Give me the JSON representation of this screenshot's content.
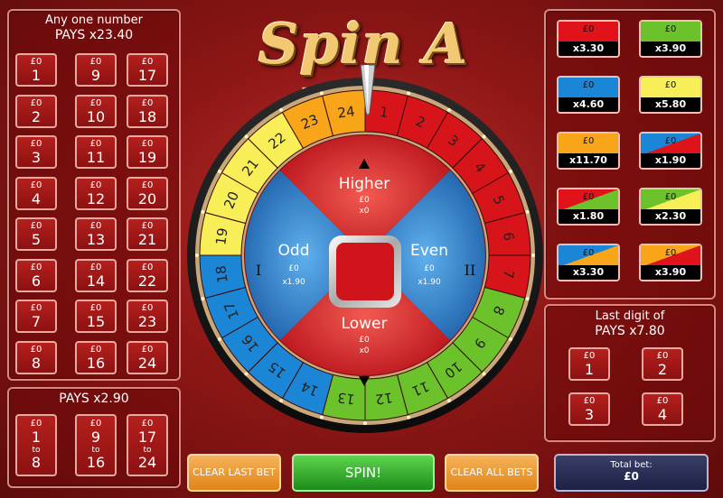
{
  "title": "Spin A Win",
  "any_number": {
    "header": "Any one number",
    "pays": "PAYS x23.40",
    "columns": [
      [
        {
          "amt": "£0",
          "num": "1"
        },
        {
          "amt": "£0",
          "num": "2"
        },
        {
          "amt": "£0",
          "num": "3"
        },
        {
          "amt": "£0",
          "num": "4"
        },
        {
          "amt": "£0",
          "num": "5"
        },
        {
          "amt": "£0",
          "num": "6"
        },
        {
          "amt": "£0",
          "num": "7"
        },
        {
          "amt": "£0",
          "num": "8"
        }
      ],
      [
        {
          "amt": "£0",
          "num": "9"
        },
        {
          "amt": "£0",
          "num": "10"
        },
        {
          "amt": "£0",
          "num": "11"
        },
        {
          "amt": "£0",
          "num": "12"
        },
        {
          "amt": "£0",
          "num": "13"
        },
        {
          "amt": "£0",
          "num": "14"
        },
        {
          "amt": "£0",
          "num": "15"
        },
        {
          "amt": "£0",
          "num": "16"
        }
      ],
      [
        {
          "amt": "£0",
          "num": "17"
        },
        {
          "amt": "£0",
          "num": "18"
        },
        {
          "amt": "£0",
          "num": "19"
        },
        {
          "amt": "£0",
          "num": "20"
        },
        {
          "amt": "£0",
          "num": "21"
        },
        {
          "amt": "£0",
          "num": "22"
        },
        {
          "amt": "£0",
          "num": "23"
        },
        {
          "amt": "£0",
          "num": "24"
        }
      ]
    ]
  },
  "range": {
    "pays": "PAYS x2.90",
    "buttons": [
      {
        "amt": "£0",
        "from": "1",
        "to_label": "to",
        "to": "8"
      },
      {
        "amt": "£0",
        "from": "9",
        "to_label": "to",
        "to": "16"
      },
      {
        "amt": "£0",
        "from": "17",
        "to_label": "to",
        "to": "24"
      }
    ]
  },
  "color_bets": [
    {
      "amt": "£0",
      "odds": "x3.30",
      "c1": "#e0121a",
      "c2": "#e0121a"
    },
    {
      "amt": "£0",
      "odds": "x3.90",
      "c1": "#6cc22a",
      "c2": "#6cc22a"
    },
    {
      "amt": "£0",
      "odds": "x4.60",
      "c1": "#1c86d6",
      "c2": "#1c86d6"
    },
    {
      "amt": "£0",
      "odds": "x5.80",
      "c1": "#f7ee58",
      "c2": "#f7ee58"
    },
    {
      "amt": "£0",
      "odds": "x11.70",
      "c1": "#f9a51a",
      "c2": "#f9a51a"
    },
    {
      "amt": "£0",
      "odds": "x1.90",
      "c1": "#1c86d6",
      "c2": "#e0121a"
    },
    {
      "amt": "£0",
      "odds": "x1.80",
      "c1": "#e0121a",
      "c2": "#6cc22a"
    },
    {
      "amt": "£0",
      "odds": "x2.30",
      "c1": "#6cc22a",
      "c2": "#f7ee58"
    },
    {
      "amt": "£0",
      "odds": "x3.30",
      "c1": "#1c86d6",
      "c2": "#f9a51a"
    },
    {
      "amt": "£0",
      "odds": "x3.90",
      "c1": "#f9a51a",
      "c2": "#e0121a"
    }
  ],
  "last_digit": {
    "header": "Last digit of",
    "pays": "PAYS x7.80",
    "buttons": [
      {
        "amt": "£0",
        "num": "1"
      },
      {
        "amt": "£0",
        "num": "2"
      },
      {
        "amt": "£0",
        "num": "3"
      },
      {
        "amt": "£0",
        "num": "4"
      }
    ]
  },
  "wheel": {
    "higher": {
      "label": "Higher",
      "amt": "£0",
      "odds": "x0"
    },
    "lower": {
      "label": "Lower",
      "amt": "£0",
      "odds": "x0"
    },
    "odd": {
      "label": "Odd",
      "amt": "£0",
      "odds": "x1.90",
      "roman": "I"
    },
    "even": {
      "label": "Even",
      "amt": "£0",
      "odds": "x1.90",
      "roman": "II"
    },
    "segments": [
      {
        "n": "1",
        "color": "#d61419"
      },
      {
        "n": "2",
        "color": "#d61419"
      },
      {
        "n": "3",
        "color": "#d61419"
      },
      {
        "n": "4",
        "color": "#d61419"
      },
      {
        "n": "5",
        "color": "#d61419"
      },
      {
        "n": "6",
        "color": "#d61419"
      },
      {
        "n": "7",
        "color": "#d61419"
      },
      {
        "n": "8",
        "color": "#6cc22a"
      },
      {
        "n": "9",
        "color": "#6cc22a"
      },
      {
        "n": "10",
        "color": "#6cc22a"
      },
      {
        "n": "11",
        "color": "#6cc22a"
      },
      {
        "n": "12",
        "color": "#6cc22a"
      },
      {
        "n": "13",
        "color": "#6cc22a"
      },
      {
        "n": "14",
        "color": "#1c86d6"
      },
      {
        "n": "15",
        "color": "#1c86d6"
      },
      {
        "n": "16",
        "color": "#1c86d6"
      },
      {
        "n": "17",
        "color": "#1c86d6"
      },
      {
        "n": "18",
        "color": "#1c86d6"
      },
      {
        "n": "19",
        "color": "#f7ee58"
      },
      {
        "n": "20",
        "color": "#f7ee58"
      },
      {
        "n": "21",
        "color": "#f7ee58"
      },
      {
        "n": "22",
        "color": "#f7ee58"
      },
      {
        "n": "23",
        "color": "#f9a51a"
      },
      {
        "n": "24",
        "color": "#f9a51a"
      }
    ]
  },
  "controls": {
    "clear_last": "CLEAR LAST BET",
    "spin": "SPIN!",
    "clear_all": "CLEAR ALL BETS",
    "total_label": "Total bet:",
    "total_value": "£0"
  }
}
